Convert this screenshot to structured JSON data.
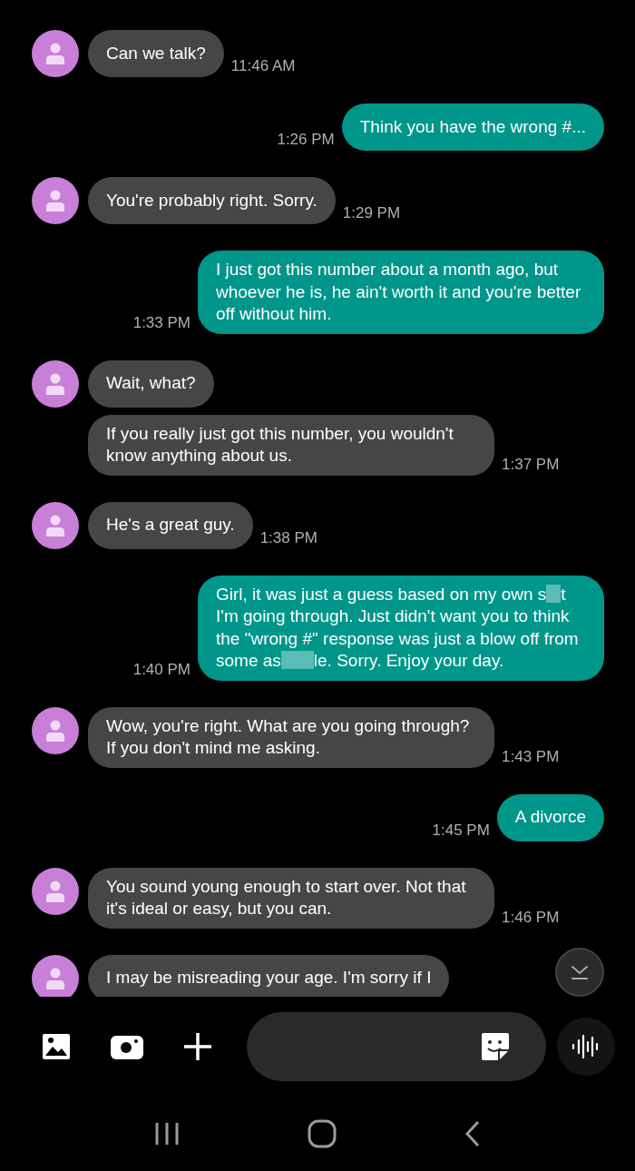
{
  "messages": [
    {
      "kind": "in",
      "avatar": true,
      "text": "Can we talk?",
      "time": "11:46 AM"
    },
    {
      "kind": "out",
      "text": "Think you have the wrong #...",
      "time": "1:26 PM"
    },
    {
      "kind": "in",
      "avatar": true,
      "text": "You're probably right. Sorry.",
      "time": "1:29 PM"
    },
    {
      "kind": "out",
      "text": "I just got this number about a month ago, but whoever he is, he ain't worth it and you're better off without him.",
      "time": "1:33 PM"
    },
    {
      "kind": "in",
      "avatar": true,
      "text": "Wait, what?"
    },
    {
      "kind": "in",
      "avatar": false,
      "text": "If you really just got this number, you wouldn't know anything about us.",
      "time": "1:37 PM"
    },
    {
      "kind": "in",
      "avatar": true,
      "text": "He's a great guy.",
      "time": "1:38 PM"
    },
    {
      "kind": "out",
      "parts": [
        {
          "kind": "text",
          "text": "Girl, it was just a guess based on my own s"
        },
        {
          "kind": "censor_short"
        },
        {
          "kind": "text",
          "text": "t I'm going through. Just didn't want you to think the \"wrong #\" response was just a blow off from some as"
        },
        {
          "kind": "censor_long"
        },
        {
          "kind": "text",
          "text": "le. Sorry. Enjoy your day."
        }
      ],
      "time": "1:40 PM"
    },
    {
      "kind": "in",
      "avatar": true,
      "text": "Wow, you're right. What are you going through? If you don't mind me asking.",
      "time": "1:43 PM"
    },
    {
      "kind": "out",
      "text": "A divorce",
      "time": "1:45 PM"
    },
    {
      "kind": "in",
      "avatar": true,
      "text": "You sound young enough to start over. Not that it's ideal or easy, but you can.",
      "time": "1:46 PM"
    },
    {
      "kind": "in",
      "avatar": true,
      "text": "I may be misreading your age. I'm sorry if I"
    }
  ]
}
